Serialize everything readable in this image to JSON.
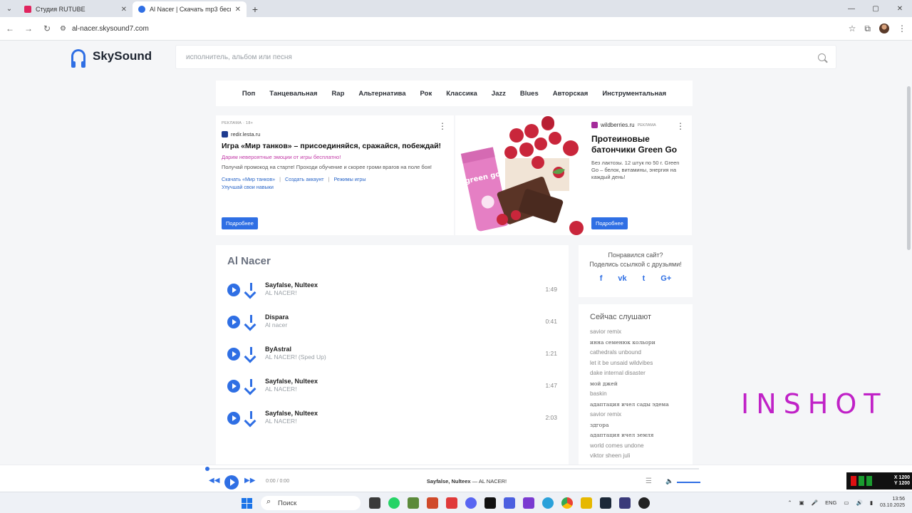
{
  "browser": {
    "tabs": [
      {
        "title": "Студия RUTUBE",
        "color": "#e0245e"
      },
      {
        "title": "Al Nacer | Скачать mp3 беспла",
        "color": "#2f6fe4"
      }
    ],
    "url": "al-nacer.skysound7.com"
  },
  "site": {
    "logo_text": "SkySound",
    "search_placeholder": "исполнитель, альбом или песня",
    "genres": [
      "Поп",
      "Танцевальная",
      "Rap",
      "Альтернатива",
      "Рок",
      "Классика",
      "Jazz",
      "Blues",
      "Авторская",
      "Инструментальная"
    ]
  },
  "ad1": {
    "label": "РЕКЛАМА · 18+",
    "source": "redir.lesta.ru",
    "title": "Игра «Мир танков» – присоединяйся, сражайся, побеждай!",
    "highlight": "Дарим невероятные эмоции от игры бесплатно!",
    "text": "Получай промокод на старте! Проходи обучение и скорее громи врагов на поле боя!",
    "links": [
      "Скачать «Мир танков»",
      "Создать аккаунт",
      "Режимы игры"
    ],
    "link_last": "Улучшай свои навыки",
    "button": "Подробнее"
  },
  "ad2": {
    "source": "wildberries.ru",
    "label": "РЕКЛАМА",
    "title": "Протеиновые батончики Green Go",
    "text": "Без лактозы. 12 штук по 50 г. Green Go – белок, витамины, энергия на каждый день!",
    "button": "Подробнее",
    "image_brand": "green go"
  },
  "artist": "Al Nacer",
  "tracks": [
    {
      "artist": "Sayfalse, Nulteex",
      "title": "AL NACER!",
      "duration": "1:49"
    },
    {
      "artist": "Dispara",
      "title": "Al nacer",
      "duration": "0:41"
    },
    {
      "artist": "ByAstral",
      "title": "AL NACER! (Sped Up)",
      "duration": "1:21"
    },
    {
      "artist": "Sayfalse, Nulteex",
      "title": "AL NACER!",
      "duration": "1:47"
    },
    {
      "artist": "Sayfalse, Nulteex",
      "title": "AL NACER!",
      "duration": "2:03"
    }
  ],
  "share": {
    "line1": "Понравился сайт?",
    "line2": "Поделись ссылкой с друзьями!",
    "icons": [
      "f",
      "vk",
      "t",
      "G+"
    ]
  },
  "now_listening": {
    "title": "Сейчас слушают",
    "items": [
      "savior remix",
      "инна семенюк кольори",
      "cathedrals unbound",
      "let it be unsaid wildvibes",
      "dake internal disaster",
      "мой джей",
      "baskin",
      "адаптация ичел сады эдема",
      "savior remix",
      "здгора",
      "адаптация ичел земля",
      "world comes undone",
      "viktor sheen juli"
    ]
  },
  "player": {
    "time": "0:00 / 0:00",
    "now_artist": "Sayfalse, Nulteex",
    "now_title": "AL NACER!",
    "progress": 0
  },
  "watermark": "INSHOT",
  "overlay": {
    "x": "X 1200",
    "y": "Y 1200"
  },
  "taskbar": {
    "search": "Поиск",
    "lang": "ENG",
    "time": "13:56",
    "date": "03.10.2025"
  }
}
